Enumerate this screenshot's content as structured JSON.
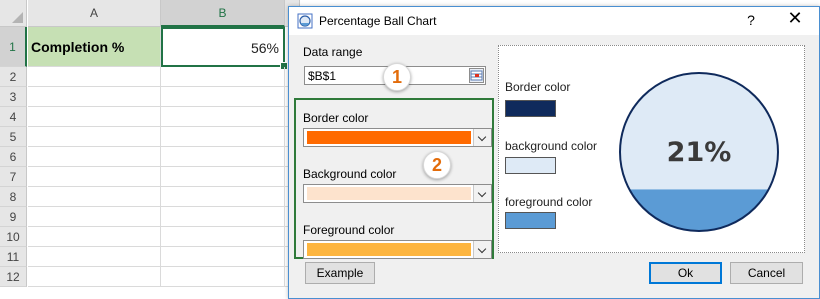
{
  "sheet": {
    "columns": [
      "A",
      "B"
    ],
    "rows": [
      "1",
      "2",
      "3",
      "4",
      "5",
      "6",
      "7",
      "8",
      "9",
      "10",
      "11",
      "12"
    ],
    "a1": "Completion %",
    "b1": "56%"
  },
  "dialog": {
    "title": "Percentage Ball Chart",
    "help": "?",
    "close": "✕",
    "data_range_label": "Data range",
    "data_range_value": "$B$1",
    "border_color_label": "Border color",
    "background_color_label": "Background color",
    "foreground_color_label": "Foreground color",
    "colors": {
      "border": "#ff6a00",
      "background": "#fde3cd",
      "foreground": "#fdb53f"
    },
    "badges": [
      "1",
      "2"
    ],
    "preview": {
      "legend": {
        "border_label": "Border color",
        "background_label": "background color",
        "foreground_label": "foreground color"
      },
      "percent_text": "21%",
      "fill_fraction": 0.21,
      "colors": {
        "border": "#0f2a5c",
        "background": "#deeaf6",
        "foreground": "#5b9bd5"
      }
    },
    "buttons": {
      "example": "Example",
      "ok": "Ok",
      "cancel": "Cancel"
    }
  }
}
